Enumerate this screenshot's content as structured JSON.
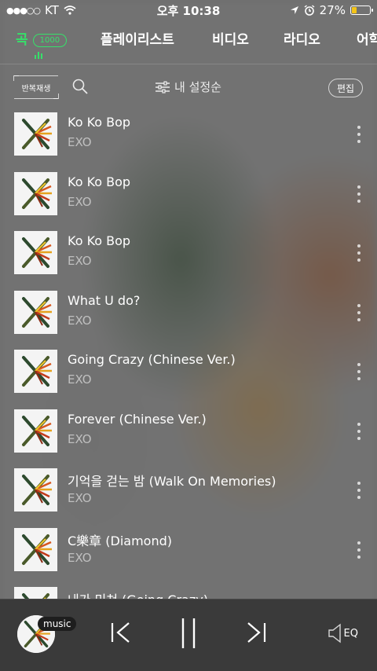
{
  "status_bar": {
    "carrier": "KT",
    "time": "오후 10:38",
    "battery": "27%"
  },
  "tabs": [
    {
      "label": "곡",
      "badge": "1000",
      "active": true
    },
    {
      "label": "플레이리스트"
    },
    {
      "label": "비디오"
    },
    {
      "label": "라디오"
    },
    {
      "label": "어학"
    }
  ],
  "toolbar": {
    "repeat_label": "반복재생",
    "sort_label": "내 설정순",
    "edit_label": "편집"
  },
  "songs": [
    {
      "title": "Ko Ko Bop",
      "artist": "EXO"
    },
    {
      "title": "Ko Ko Bop",
      "artist": "EXO"
    },
    {
      "title": "Ko Ko Bop",
      "artist": "EXO"
    },
    {
      "title": "What U do?",
      "artist": "EXO"
    },
    {
      "title": "Going Crazy (Chinese Ver.)",
      "artist": "EXO"
    },
    {
      "title": "Forever (Chinese Ver.)",
      "artist": "EXO"
    },
    {
      "title": "기억을 걷는 밤 (Walk On Memories)",
      "artist": "EXO"
    },
    {
      "title": "C樂章 (Diamond)",
      "artist": "EXO"
    },
    {
      "title": "내가 미쳐 (Going Crazy)",
      "artist": ""
    }
  ],
  "player": {
    "badge": "music",
    "eq_label": "EQ"
  },
  "colors": {
    "accent": "#36e16a",
    "player_bg": "#3a3a3a",
    "battery": "#f3c417"
  }
}
